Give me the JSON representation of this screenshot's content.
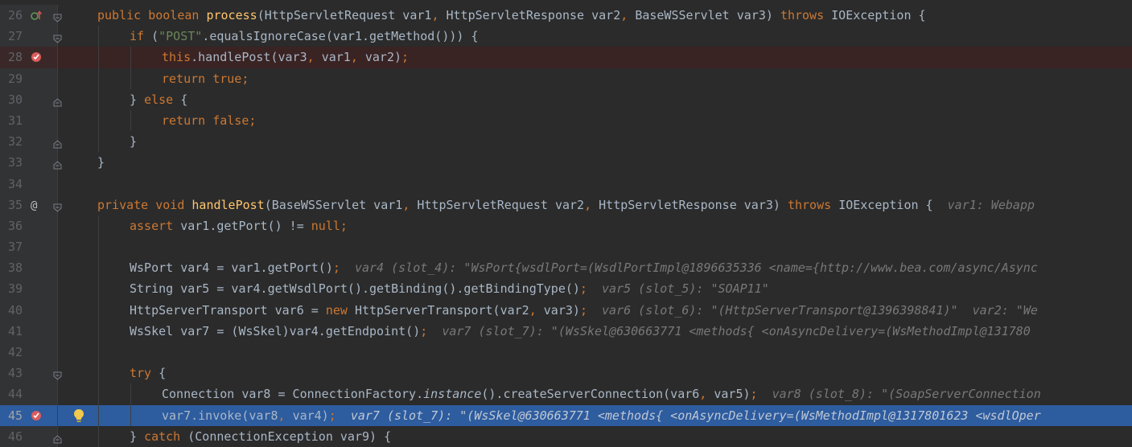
{
  "editor": {
    "language": "java",
    "lines": [
      {
        "n": "26",
        "marker": "override-icon",
        "fold": "fold-start",
        "indent": 1,
        "tokens": [
          [
            "kw",
            "public "
          ],
          [
            "kw",
            "boolean "
          ],
          [
            "fn",
            "process"
          ],
          [
            "p",
            "(HttpServletRequest var1"
          ],
          [
            "kw",
            ", "
          ],
          [
            "p",
            "HttpServletResponse var2"
          ],
          [
            "kw",
            ", "
          ],
          [
            "p",
            "BaseWSServlet var3) "
          ],
          [
            "kw",
            "throws "
          ],
          [
            "p",
            "IOException {"
          ]
        ]
      },
      {
        "n": "27",
        "fold": "fold-start",
        "indent": 2,
        "tokens": [
          [
            "kw",
            "if "
          ],
          [
            "p",
            "("
          ],
          [
            "str",
            "\"POST\""
          ],
          [
            "p",
            ".equalsIgnoreCase(var1.getMethod())) {"
          ]
        ]
      },
      {
        "n": "28",
        "marker": "breakpoint-icon",
        "highlight": "breakpoint",
        "indent": 3,
        "tokens": [
          [
            "kw",
            "this"
          ],
          [
            "p",
            ".handlePost(var3"
          ],
          [
            "kw",
            ", "
          ],
          [
            "p",
            "var1"
          ],
          [
            "kw",
            ", "
          ],
          [
            "p",
            "var2)"
          ],
          [
            "kw",
            ";"
          ]
        ]
      },
      {
        "n": "29",
        "indent": 3,
        "tokens": [
          [
            "kw",
            "return "
          ],
          [
            "kw",
            "true;"
          ]
        ]
      },
      {
        "n": "30",
        "fold": "fold-mid",
        "indent": 2,
        "tokens": [
          [
            "p",
            "} "
          ],
          [
            "kw",
            "else "
          ],
          [
            "p",
            "{"
          ]
        ]
      },
      {
        "n": "31",
        "indent": 3,
        "tokens": [
          [
            "kw",
            "return "
          ],
          [
            "kw",
            "false;"
          ]
        ]
      },
      {
        "n": "32",
        "fold": "fold-end",
        "indent": 2,
        "tokens": [
          [
            "p",
            "}"
          ]
        ]
      },
      {
        "n": "33",
        "fold": "fold-end",
        "indent": 1,
        "tokens": [
          [
            "p",
            "}"
          ]
        ]
      },
      {
        "n": "34",
        "indent": 1,
        "tokens": []
      },
      {
        "n": "35",
        "marker": "annotation-at-icon",
        "fold": "fold-start",
        "indent": 1,
        "tokens": [
          [
            "kw",
            "private "
          ],
          [
            "kw",
            "void "
          ],
          [
            "fn",
            "handlePost"
          ],
          [
            "p",
            "(BaseWSServlet var1"
          ],
          [
            "kw",
            ", "
          ],
          [
            "p",
            "HttpServletRequest var2"
          ],
          [
            "kw",
            ", "
          ],
          [
            "p",
            "HttpServletResponse var3) "
          ],
          [
            "kw",
            "throws "
          ],
          [
            "p",
            "IOException {  "
          ],
          [
            "hint",
            "var1: Webapp"
          ]
        ]
      },
      {
        "n": "36",
        "indent": 2,
        "tokens": [
          [
            "kw",
            "assert "
          ],
          [
            "p",
            "var1.getPort() != "
          ],
          [
            "kw",
            "null;"
          ]
        ]
      },
      {
        "n": "37",
        "indent": 2,
        "tokens": []
      },
      {
        "n": "38",
        "indent": 2,
        "tokens": [
          [
            "p",
            "WsPort var4 = var1.getPort()"
          ],
          [
            "kw",
            ";  "
          ],
          [
            "hint",
            "var4 (slot_4): \"WsPort{wsdlPort=(WsdlPortImpl@1896635336 <name={http://www.bea.com/async/Async"
          ]
        ]
      },
      {
        "n": "39",
        "indent": 2,
        "tokens": [
          [
            "p",
            "String var5 = var4.getWsdlPort().getBinding().getBindingType()"
          ],
          [
            "kw",
            ";  "
          ],
          [
            "hint",
            "var5 (slot_5): \"SOAP11\""
          ]
        ]
      },
      {
        "n": "40",
        "indent": 2,
        "tokens": [
          [
            "p",
            "HttpServerTransport var6 = "
          ],
          [
            "kw",
            "new "
          ],
          [
            "p",
            "HttpServerTransport(var2"
          ],
          [
            "kw",
            ", "
          ],
          [
            "p",
            "var3)"
          ],
          [
            "kw",
            ";  "
          ],
          [
            "hint",
            "var6 (slot_6): \"(HttpServerTransport@1396398841)\"  var2: \"We"
          ]
        ]
      },
      {
        "n": "41",
        "indent": 2,
        "tokens": [
          [
            "p",
            "WsSkel var7 = (WsSkel)var4.getEndpoint()"
          ],
          [
            "kw",
            ";  "
          ],
          [
            "hint",
            "var7 (slot_7): \"(WsSkel@630663771 <methods{ <onAsyncDelivery=(WsMethodImpl@131780"
          ]
        ]
      },
      {
        "n": "42",
        "indent": 2,
        "tokens": []
      },
      {
        "n": "43",
        "fold": "fold-start",
        "indent": 2,
        "tokens": [
          [
            "kw",
            "try "
          ],
          [
            "p",
            "{"
          ]
        ]
      },
      {
        "n": "44",
        "indent": 3,
        "tokens": [
          [
            "p",
            "Connection var8 = ConnectionFactory."
          ],
          [
            "it",
            "instance"
          ],
          [
            "p",
            "().createServerConnection(var6"
          ],
          [
            "kw",
            ", "
          ],
          [
            "p",
            "var5)"
          ],
          [
            "kw",
            ";  "
          ],
          [
            "hint",
            "var8 (slot_8): \"(SoapServerConnection"
          ]
        ]
      },
      {
        "n": "45",
        "marker": "breakpoint-icon",
        "bulb": true,
        "highlight": "current",
        "indent": 3,
        "tokens": [
          [
            "p",
            "var7.invoke(var8"
          ],
          [
            "kw",
            ", "
          ],
          [
            "p",
            "var4)"
          ],
          [
            "kw",
            ";  "
          ],
          [
            "hint",
            "var7 (slot_7): \"(WsSkel@630663771 <methods{ <onAsyncDelivery=(WsMethodImpl@1317801623 <wsdlOper"
          ]
        ]
      },
      {
        "n": "46",
        "fold": "fold-mid",
        "indent": 2,
        "tokens": [
          [
            "p",
            "} "
          ],
          [
            "kw",
            "catch "
          ],
          [
            "p",
            "(ConnectionException var9) {"
          ]
        ]
      }
    ]
  },
  "colors": {
    "background": "#2b2b2b",
    "gutter": "#313335",
    "keyword": "#cc7832",
    "function": "#ffc66d",
    "string": "#6a8759",
    "text": "#a9b7c6",
    "hint": "#787878",
    "current_line": "#2d5c9f",
    "breakpoint_line": "#3a2323",
    "breakpoint": "#db5c5c"
  }
}
